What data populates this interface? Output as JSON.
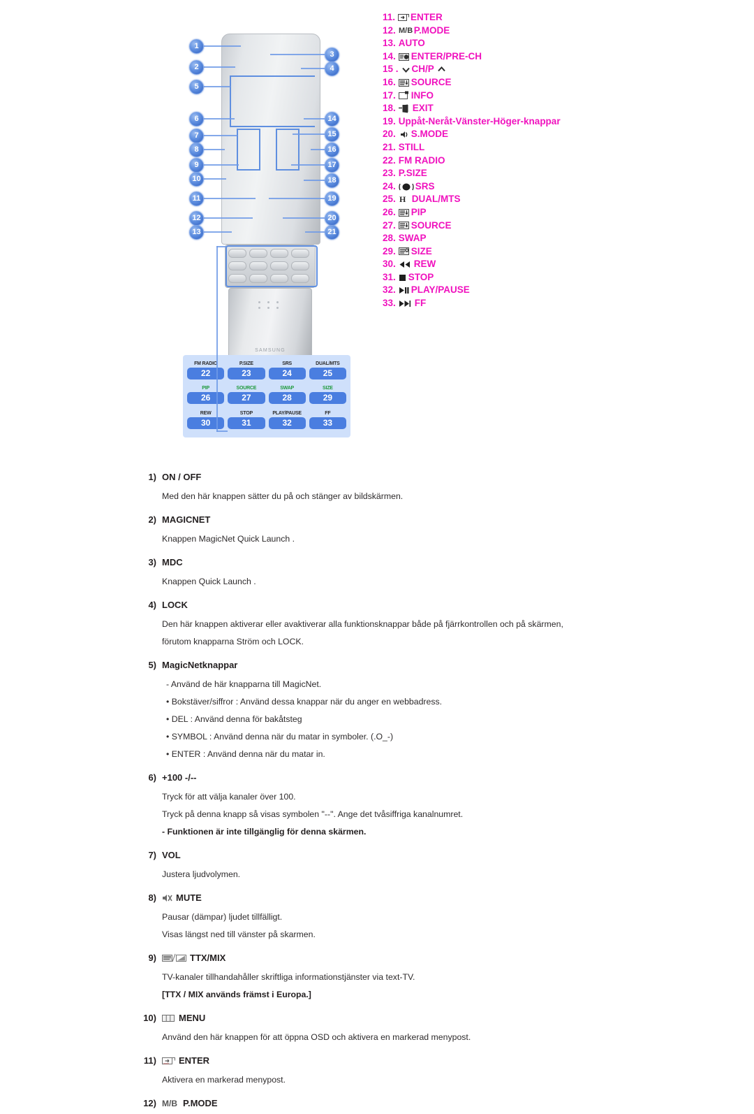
{
  "document": {
    "language": "sv",
    "accent_color": "#f012be",
    "text_color": "#231f20"
  },
  "remote_figure": {
    "brand": "SAMSUNG",
    "callouts": [
      {
        "n": "1"
      },
      {
        "n": "2"
      },
      {
        "n": "3"
      },
      {
        "n": "4"
      },
      {
        "n": "5"
      },
      {
        "n": "6"
      },
      {
        "n": "7"
      },
      {
        "n": "8"
      },
      {
        "n": "9"
      },
      {
        "n": "10"
      },
      {
        "n": "11"
      },
      {
        "n": "12"
      },
      {
        "n": "13"
      },
      {
        "n": "14"
      },
      {
        "n": "15"
      },
      {
        "n": "16"
      },
      {
        "n": "17"
      },
      {
        "n": "18"
      },
      {
        "n": "19"
      },
      {
        "n": "20"
      },
      {
        "n": "21"
      }
    ],
    "keypad_legend": [
      {
        "label": "FM RADIO",
        "key": "22",
        "green": false
      },
      {
        "label": "P.SIZE",
        "key": "23",
        "green": false
      },
      {
        "label": "SRS",
        "key": "24",
        "green": false
      },
      {
        "label": "DUAL/MTS",
        "key": "25",
        "green": false
      },
      {
        "label": "PIP",
        "key": "26",
        "green": true
      },
      {
        "label": "SOURCE",
        "key": "27",
        "green": true
      },
      {
        "label": "SWAP",
        "key": "28",
        "green": true
      },
      {
        "label": "SIZE",
        "key": "29",
        "green": true
      },
      {
        "label": "REW",
        "key": "30",
        "green": false
      },
      {
        "label": "STOP",
        "key": "31",
        "green": false
      },
      {
        "label": "PLAY/PAUSE",
        "key": "32",
        "green": false
      },
      {
        "label": "FF",
        "key": "33",
        "green": false
      }
    ]
  },
  "legend": [
    {
      "num": "11.",
      "icon": "enter-icon",
      "label": "ENTER"
    },
    {
      "num": "12.",
      "icon": "mb-icon",
      "label": "P.MODE"
    },
    {
      "num": "13.",
      "icon": "",
      "label": "AUTO"
    },
    {
      "num": "14.",
      "icon": "enter-prech-icon",
      "label": "ENTER/PRE-CH"
    },
    {
      "num": "15 .",
      "icon": "chp-icon",
      "label": "CH/P"
    },
    {
      "num": "16.",
      "icon": "source-icon",
      "label": "SOURCE"
    },
    {
      "num": "17.",
      "icon": "info-icon",
      "label": "INFO"
    },
    {
      "num": "18.",
      "icon": "exit-icon",
      "label": "EXIT"
    },
    {
      "num": "19.",
      "icon": "",
      "label": "Uppåt-Neråt-Vänster-Höger-knappar"
    },
    {
      "num": "20.",
      "icon": "smode-icon",
      "label": "S.MODE"
    },
    {
      "num": "21.",
      "icon": "",
      "label": "STILL"
    },
    {
      "num": "22.",
      "icon": "",
      "label": "FM RADIO"
    },
    {
      "num": "23.",
      "icon": "",
      "label": "P.SIZE"
    },
    {
      "num": "24.",
      "icon": "srs-icon",
      "label": "SRS"
    },
    {
      "num": "25.",
      "icon": "dualmts-icon",
      "label": "DUAL/MTS"
    },
    {
      "num": "26.",
      "icon": "pip-icon",
      "label": "PIP"
    },
    {
      "num": "27.",
      "icon": "source-icon",
      "label": "SOURCE"
    },
    {
      "num": "28.",
      "icon": "",
      "label": "SWAP"
    },
    {
      "num": "29.",
      "icon": "size-icon",
      "label": "SIZE"
    },
    {
      "num": "30.",
      "icon": "rew-icon",
      "label": "REW"
    },
    {
      "num": "31.",
      "icon": "stop-icon",
      "label": "STOP"
    },
    {
      "num": "32.",
      "icon": "playpause-icon",
      "label": "PLAY/PAUSE"
    },
    {
      "num": "33.",
      "icon": "ff-icon",
      "label": "FF"
    }
  ],
  "descriptions": [
    {
      "num": "1)",
      "icon": "",
      "title": "ON / OFF",
      "lines": [
        {
          "text": "Med den här knappen sätter du på och stänger av bildskärmen.",
          "bold": false
        }
      ]
    },
    {
      "num": "2)",
      "icon": "",
      "title": "MAGICNET",
      "lines": [
        {
          "text": "Knappen MagicNet Quick Launch .",
          "bold": false
        }
      ]
    },
    {
      "num": "3)",
      "icon": "",
      "title": "MDC",
      "lines": [
        {
          "text": "Knappen Quick Launch .",
          "bold": false
        }
      ]
    },
    {
      "num": "4)",
      "icon": "",
      "title": "LOCK",
      "lines": [
        {
          "text": "Den här knappen aktiverar eller avaktiverar alla funktionsknappar både på fjärrkontrollen och på skärmen,",
          "bold": false
        },
        {
          "text": "förutom knapparna Ström och LOCK.",
          "bold": false
        }
      ]
    },
    {
      "num": "5)",
      "icon": "",
      "title": "MagicNetknappar",
      "lines": [
        {
          "text": "- Använd de här knapparna till MagicNet.",
          "bold": false,
          "bullet": true
        },
        {
          "text": "• Bokstäver/siffror : Använd dessa knappar när du anger en webbadress.",
          "bold": false,
          "bullet": true
        },
        {
          "text": "• DEL : Använd denna för bakåtsteg",
          "bold": false,
          "bullet": true
        },
        {
          "text": "• SYMBOL : Använd denna när du matar in symboler. (.O_-)",
          "bold": false,
          "bullet": true
        },
        {
          "text": "• ENTER : Använd denna när du matar in.",
          "bold": false,
          "bullet": true
        }
      ]
    },
    {
      "num": "6)",
      "icon": "",
      "title": "+100 -/--",
      "lines": [
        {
          "text": "Tryck för att välja kanaler över 100.",
          "bold": false
        },
        {
          "text": "Tryck på denna knapp så visas symbolen \"--\". Ange det tvåsiffriga kanalnumret.",
          "bold": false
        },
        {
          "text": "- Funktionen är inte tillgänglig för denna skärmen.",
          "bold": true
        }
      ]
    },
    {
      "num": "7)",
      "icon": "",
      "title": "VOL",
      "lines": [
        {
          "text": "Justera ljudvolymen.",
          "bold": false
        }
      ]
    },
    {
      "num": "8)",
      "icon": "mute-icon",
      "title": "MUTE",
      "lines": [
        {
          "text": "Pausar (dämpar) ljudet tillfälligt.",
          "bold": false
        },
        {
          "text": "Visas längst ned till vänster på skarmen.",
          "bold": false
        }
      ]
    },
    {
      "num": "9)",
      "icon": "ttxmix-icon",
      "title": "TTX/MIX",
      "lines": [
        {
          "text": "TV-kanaler tillhandahåller skriftliga informationstjänster via text-TV.",
          "bold": false
        },
        {
          "text": "[TTX / MIX används främst i Europa.]",
          "bold": true
        }
      ]
    },
    {
      "num": "10)",
      "icon": "menu-icon",
      "title": "MENU",
      "lines": [
        {
          "text": "Använd den här knappen för att öppna OSD och aktivera en markerad menypost.",
          "bold": false
        }
      ]
    },
    {
      "num": "11)",
      "icon": "enter-icon",
      "title": "ENTER",
      "lines": [
        {
          "text": "Aktivera en markerad menypost.",
          "bold": false
        }
      ]
    },
    {
      "num": "12)",
      "icon": "mb-icon",
      "title": "P.MODE",
      "lines": []
    }
  ]
}
